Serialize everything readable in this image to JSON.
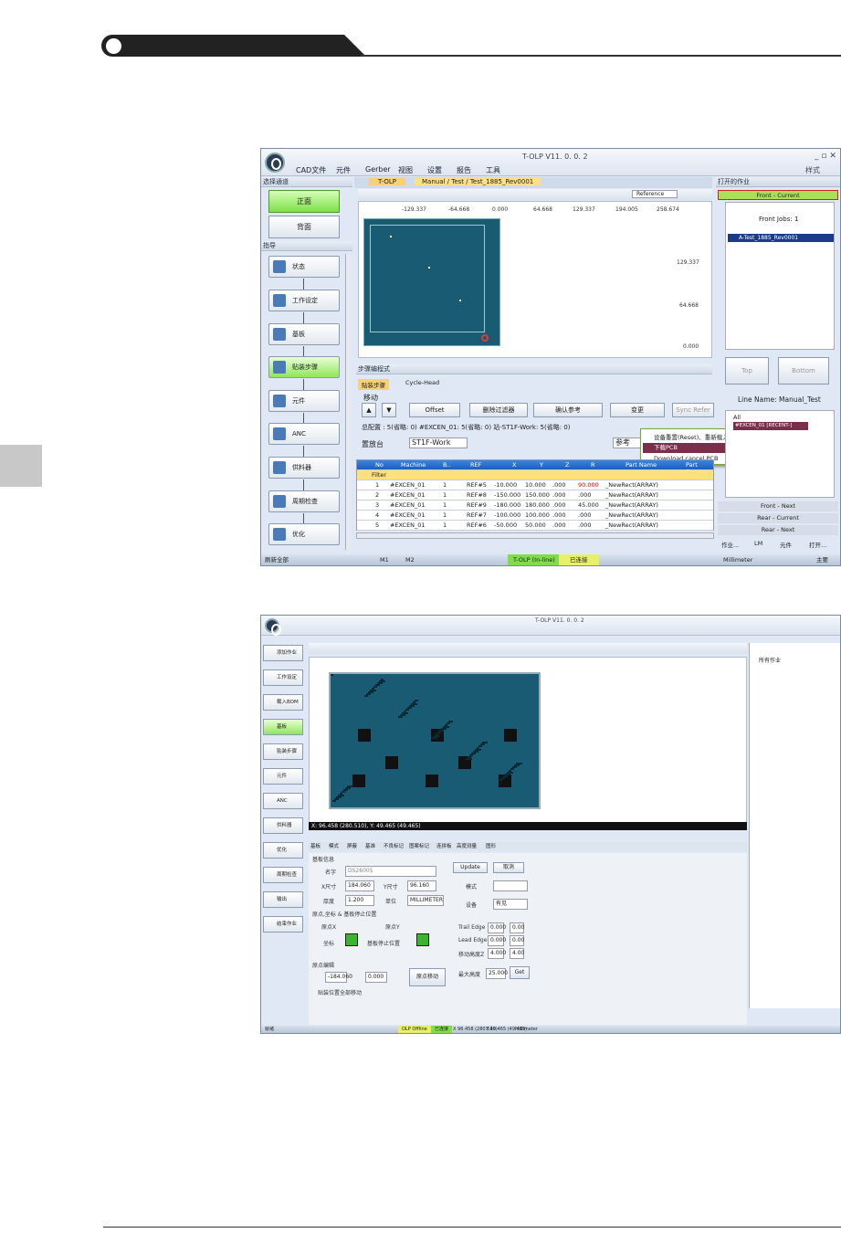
{
  "screenshot1": {
    "title": "T-OLP V11. 0. 0. 2",
    "style_label": "样式",
    "menu": [
      "CAD文件",
      "元件",
      "Gerber",
      "视图",
      "设置",
      "报告",
      "工具"
    ],
    "left_pane_title": "选择通道",
    "channel_buttons": [
      "正面",
      "背面"
    ],
    "guide_title": "指导",
    "workflow": [
      "状态",
      "工作设定",
      "基板",
      "贴装步骤",
      "元件",
      "ANC",
      "供料器",
      "周期检查",
      "优化"
    ],
    "tabs": [
      "T-OLP",
      "Manual / Test / Test_1885_Rev0001"
    ],
    "reference_label": "Reference",
    "x_ticks": [
      "-129.337",
      "-64.668",
      "0.000",
      "64.668",
      "129.337",
      "194.005",
      "258.674"
    ],
    "y_ticks": [
      "129.337",
      "64.668",
      "0.000"
    ],
    "step_panel_title": "步骤编程式",
    "step_tabs": [
      "贴装步骤",
      "Cycle-Head"
    ],
    "move_label": "移动",
    "buttons": [
      "Offset",
      "删除过滤器",
      "确认参考",
      "变更",
      "Sync Refer"
    ],
    "summary": "总配置 : 5(省略: 0)  #EXCEN_01: 5(省略: 0)  站-ST1F-Work: 5(省略: 0)",
    "station_label": "置放台",
    "station_value": "ST1F-Work",
    "ref_label": "参考",
    "context_menu": [
      "设备重置(Reset)、重新载入设定值(Settings)",
      "下载PCB",
      "Download cancel PCB"
    ],
    "table_headers": [
      "No",
      "Machine",
      "B..",
      "REF",
      "X",
      "Y",
      "Z",
      "R",
      "Part Name",
      "Part Desc"
    ],
    "filter_label": "Filter",
    "table_rows": [
      [
        "1",
        "#EXCEN_01",
        "1",
        "REF#5",
        "-10.000",
        "10.000",
        ".000",
        "90.000",
        "_NewRect(ARRAY)"
      ],
      [
        "2",
        "#EXCEN_01",
        "1",
        "REF#8",
        "-150.000",
        "150.000",
        ".000",
        ".000",
        "_NewRect(ARRAY)"
      ],
      [
        "3",
        "#EXCEN_01",
        "1",
        "REF#9",
        "-180.000",
        "180.000",
        ".000",
        "45.000",
        "_NewRect(ARRAY)"
      ],
      [
        "4",
        "#EXCEN_01",
        "1",
        "REF#7",
        "-100.000",
        "100.000",
        ".000",
        ".000",
        "_NewRect(ARRAY)"
      ],
      [
        "5",
        "#EXCEN_01",
        "1",
        "REF#6",
        "-50.000",
        "50.000",
        ".000",
        ".000",
        "_NewRect(ARRAY)"
      ]
    ],
    "open_jobs_title": "打开的作业",
    "front_current": "Front  -  Current",
    "front_jobs": "Front Jobs: 1",
    "job_item": "A-Test_1885_Rev0001",
    "top_btn": "Top",
    "bottom_btn": "Bottom",
    "line_name": "Line Name: Manual_Test",
    "tree_all": "All",
    "tree_item": "#EXCEN_01 [RECENT-]",
    "queue": [
      "Front  -  Next",
      "Rear  -  Current",
      "Rear  -  Next"
    ],
    "bottom_tabs": [
      "作业...",
      "LM",
      "元件",
      "打开..."
    ],
    "status": [
      "刷新全部",
      "M1",
      "M2",
      "T-OLP (In-line)",
      "已连接",
      "Millimeter",
      "主要"
    ]
  },
  "screenshot2": {
    "title": "T-OLP V11. 0. 0. 2",
    "workflow": [
      "添加作业",
      "工作设定",
      "载入BOM",
      "基板",
      "贴装步骤",
      "元件",
      "ANC",
      "供料器",
      "优化",
      "周期检查",
      "输出",
      "结束作业"
    ],
    "coord_readout": "X: 96.458 (280.510), Y: 49.465 (49.465)",
    "prop_tabs": [
      "基板",
      "模式",
      "屏蔽",
      "基准",
      "不良标记",
      "图案标记",
      "连拼板",
      "高度测量",
      "图形"
    ],
    "board_info": "基板信息",
    "name_label": "名字",
    "name_value": "DS26005",
    "x_size_label": "X尺寸",
    "x_size": "184.060",
    "y_size_label": "Y尺寸",
    "y_size": "96.160",
    "thick_label": "厚度",
    "thick": "1.200",
    "unit_label": "单位",
    "unit": "MILLIMETER",
    "update_btn": "Update",
    "cancel_btn": "取消",
    "mode_label": "模式",
    "settings_label": "设备",
    "settings_value": "有见",
    "origin_section": "原点,坐标 & 基板停止位置",
    "origin_x": "原点X",
    "origin_y": "原点Y",
    "coord_label": "坐标",
    "stop_label": "基板停止位置",
    "trail": "Trail Edge",
    "lead": "Lead Edge",
    "move_height": "移动高度Z",
    "edge_vals": [
      "0.000",
      "0.000",
      "4.000"
    ],
    "edge_vals2": [
      "0.00",
      "0.00",
      "4.00"
    ],
    "origin_edit": "原点编辑",
    "ox": "-184.060",
    "oy": "0.000",
    "origin_move": "原点移动",
    "max_height_label": "最大高度",
    "max_height": "25.000",
    "get_btn": "Get",
    "apply_all": "贴装位置全部移动",
    "tree_root": "所有作业",
    "status": [
      "就绪",
      "OLP Offline",
      "已连接",
      "X 96.458 (280.510)",
      "Y 49.465 (49.465)",
      "Millimeter"
    ]
  }
}
